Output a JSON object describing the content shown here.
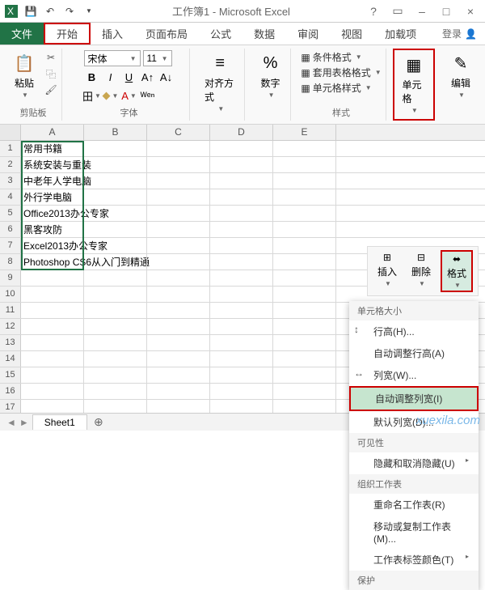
{
  "title": "工作簿1 - Microsoft Excel",
  "qat": {
    "save": "保存",
    "undo": "撤销",
    "redo": "重做"
  },
  "win": {
    "help": "?",
    "min": "–",
    "max": "□",
    "close": "×"
  },
  "tabs": {
    "file": "文件",
    "home": "开始",
    "insert": "插入",
    "layout": "页面布局",
    "formula": "公式",
    "data": "数据",
    "review": "审阅",
    "view": "视图",
    "addins": "加载项",
    "login": "登录"
  },
  "ribbon": {
    "clipboard": "粘贴",
    "clipboard_label": "剪贴板",
    "font_name": "宋体",
    "font_size": "11",
    "font_label": "字体",
    "align_label": "对齐方式",
    "number_label": "数字",
    "cond_format": "条件格式",
    "table_format": "套用表格格式",
    "cell_style": "单元格样式",
    "styles_label": "样式",
    "cells_label": "单元格",
    "edit_label": "编辑"
  },
  "format_ribbon": {
    "insert": "插入",
    "delete": "删除",
    "format": "格式"
  },
  "menu": {
    "section_size": "单元格大小",
    "row_height": "行高(H)...",
    "auto_row": "自动调整行高(A)",
    "col_width": "列宽(W)...",
    "auto_col": "自动调整列宽(I)",
    "default_width": "默认列宽(D)...",
    "section_vis": "可见性",
    "hide": "隐藏和取消隐藏(U)",
    "section_org": "组织工作表",
    "rename": "重命名工作表(R)",
    "move": "移动或复制工作表(M)...",
    "tab_color": "工作表标签颜色(T)",
    "section_protect": "保护"
  },
  "columns": [
    "A",
    "B",
    "C",
    "D",
    "E"
  ],
  "cells": [
    "常用书籍",
    "系统安装与重装",
    "中老年人学电脑",
    "外行学电脑",
    "Office2013办公专家",
    "黑客攻防",
    "Excel2013办公专家",
    "Photoshop CS6从入门到精通"
  ],
  "row_count": 17,
  "sheet": {
    "name": "Sheet1"
  },
  "watermark": "xuexila.com"
}
